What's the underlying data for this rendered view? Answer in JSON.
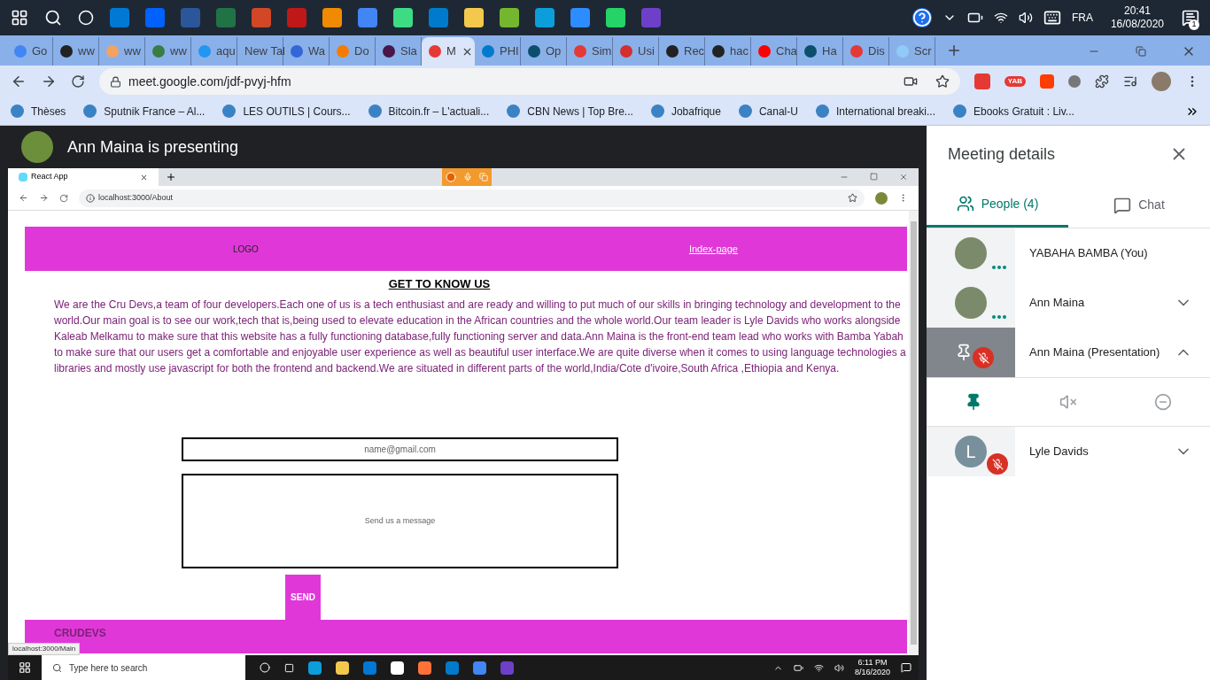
{
  "os_taskbar": {
    "language": "FRA",
    "time": "20:41",
    "date": "16/08/2020",
    "notifications": "1"
  },
  "browser": {
    "tabs": [
      {
        "label": "Go",
        "selected": false
      },
      {
        "label": "ww",
        "selected": false
      },
      {
        "label": "ww",
        "selected": false
      },
      {
        "label": "ww",
        "selected": false
      },
      {
        "label": "aqu",
        "selected": false
      },
      {
        "label": "New Tal",
        "selected": false
      },
      {
        "label": "Wa",
        "selected": false
      },
      {
        "label": "Do",
        "selected": false
      },
      {
        "label": "Sla",
        "selected": false
      },
      {
        "label": "M",
        "selected": true
      },
      {
        "label": "PHI",
        "selected": false
      },
      {
        "label": "Op",
        "selected": false
      },
      {
        "label": "Sim",
        "selected": false
      },
      {
        "label": "Usi",
        "selected": false
      },
      {
        "label": "Rec",
        "selected": false
      },
      {
        "label": "hac",
        "selected": false
      },
      {
        "label": "Cha",
        "selected": false
      },
      {
        "label": "Ha",
        "selected": false
      },
      {
        "label": "Dis",
        "selected": false
      },
      {
        "label": "Scr",
        "selected": false
      }
    ],
    "address": "meet.google.com/jdf-pvyj-hfm",
    "extension_badge": "YAB",
    "bookmarks": [
      "Thèses",
      "Sputnik France – Al...",
      "LES OUTILS | Cours...",
      "Bitcoin.fr – L'actuali...",
      "CBN News | Top Bre...",
      "Jobafrique",
      "Canal-U",
      "International breaki...",
      "Ebooks Gratuit : Liv..."
    ]
  },
  "meet": {
    "presenter_banner": "Ann Maina is presenting",
    "panel": {
      "title": "Meeting details",
      "tabs": [
        {
          "label": "People (4)",
          "selected": true
        },
        {
          "label": "Chat",
          "selected": false
        }
      ],
      "people": [
        {
          "name": "YABAHA BAMBA (You)",
          "kind": "self",
          "muted": false,
          "expanded": false
        },
        {
          "name": "Ann Maina",
          "kind": "participant",
          "muted": false,
          "expanded": false
        },
        {
          "name": "Ann Maina (Presentation)",
          "kind": "presentation",
          "muted": true,
          "expanded": true
        },
        {
          "name": "Lyle Davids",
          "kind": "participant",
          "initial": "L",
          "muted": true,
          "expanded": false
        }
      ]
    }
  },
  "shared_screen": {
    "tab_title": "React App",
    "url": "localhost:3000/About",
    "page": {
      "logo": "LOGO",
      "nav_link": "Index-page",
      "heading": "GET TO KNOW US",
      "paragraph_lines": [
        "We are the Cru Devs,a team of four developers.Each one of us is a tech enthusiast and are ready and willing to put much of our skills in bringing technology and development to the",
        "world.Our main goal is to see our work,tech that is,being used to elevate education in the African countries and the whole world.Our team leader is Lyle Davids who works alongside",
        "Kaleab Melkamu to make sure that this website has a fully functioning database,fully functioning server and data.Ann Maina is the front-end team lead who works with Bamba Yabah",
        "to make sure that our users get a comfortable and enjoyable user experience as well as beautiful user interface.We are quite diverse when it comes to using language technologies a",
        "libraries and mostly use javascript for both the frontend and backend.We are situated in different parts of the world,India/Cote d'ivoire,South Africa ,Ethiopia and Kenya."
      ],
      "email_placeholder": "name@gmail.com",
      "message_placeholder": "Send us a message",
      "send_button": "SEND",
      "footer": "CRUDEVS"
    },
    "status_url": "localhost:3000/Main",
    "taskbar": {
      "search_placeholder": "Type here to search",
      "time": "6:11 PM",
      "date": "8/16/2020"
    }
  }
}
